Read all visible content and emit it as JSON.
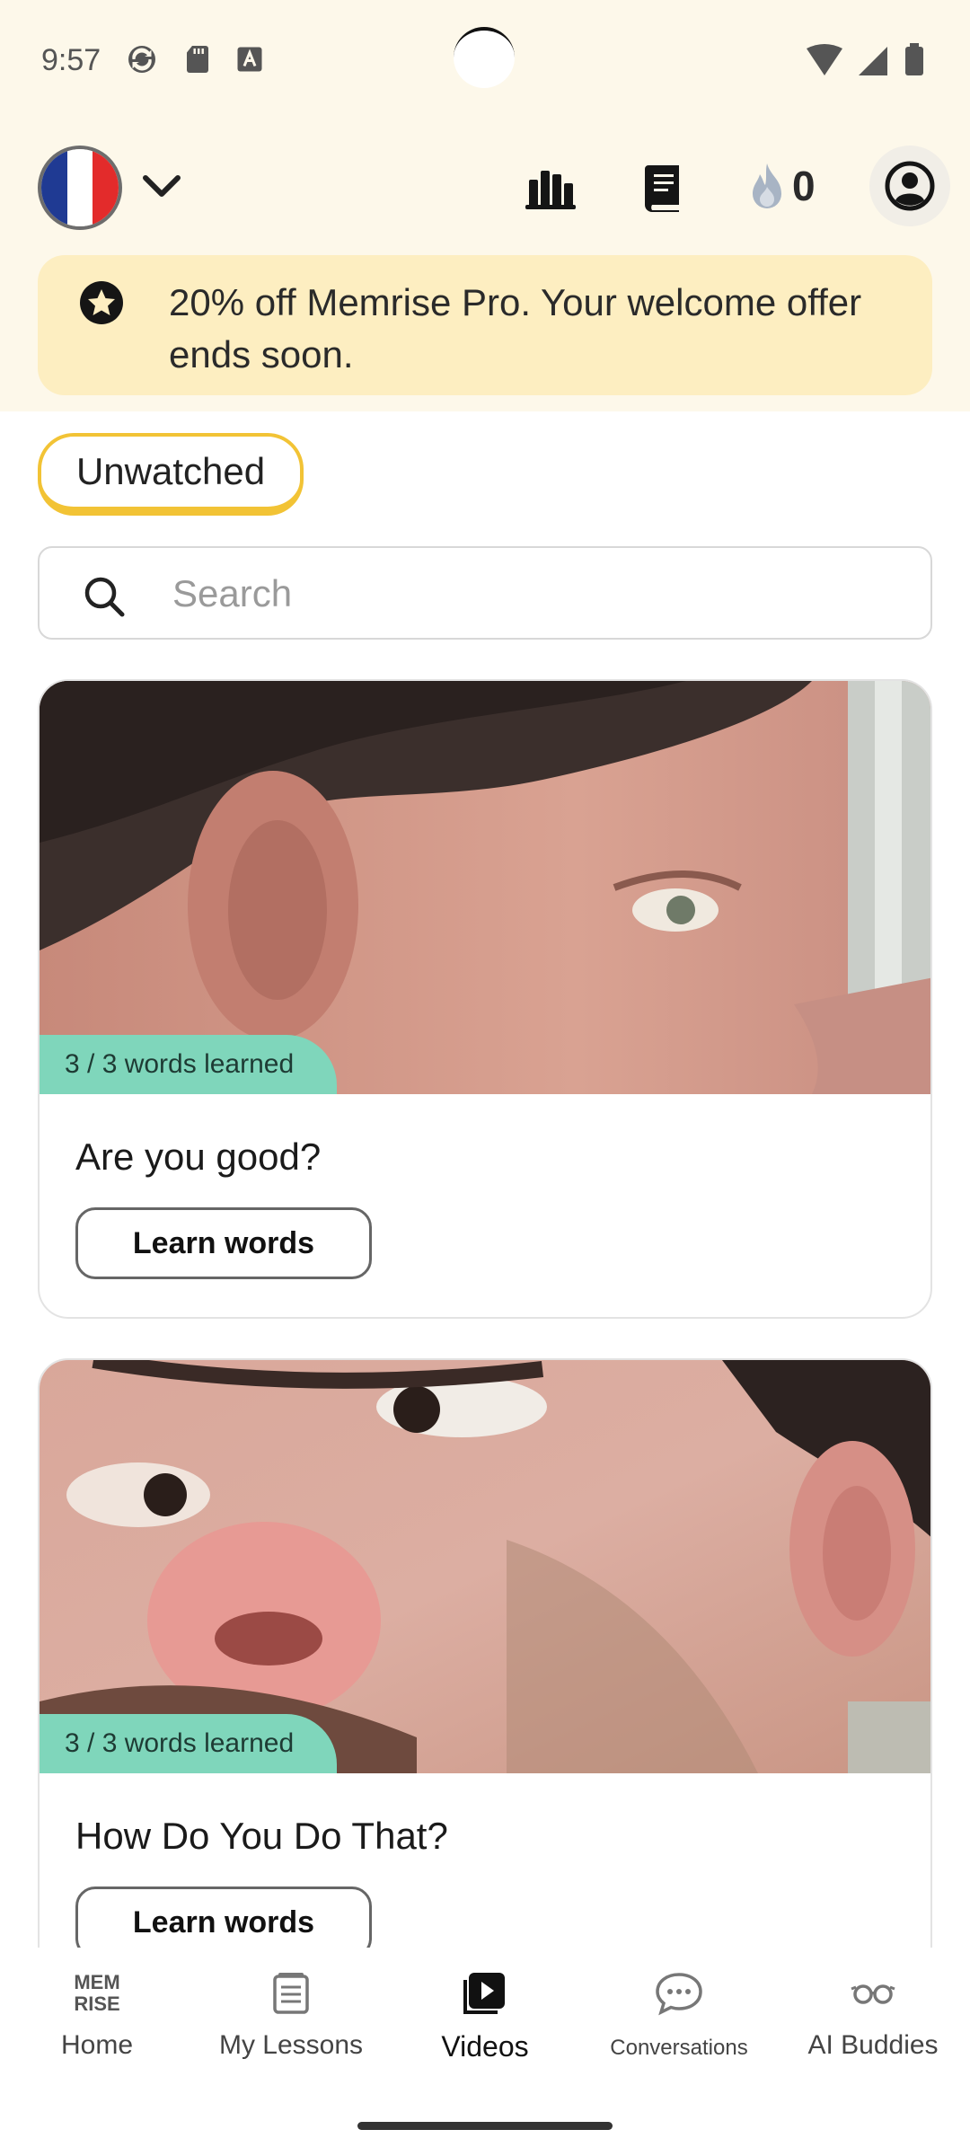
{
  "status_bar": {
    "time": "9:57"
  },
  "header": {
    "language_flag": "france-flag",
    "streak_count": "0"
  },
  "promo": {
    "text": "20% off Memrise Pro. Your welcome offer ends soon."
  },
  "filter": {
    "label": "Unwatched"
  },
  "search": {
    "placeholder": "Search"
  },
  "videos": [
    {
      "badge": "3 / 3 words learned",
      "title": "Are you good?",
      "button": "Learn words"
    },
    {
      "badge": "3 / 3 words learned",
      "title": "How Do You Do That?",
      "button": "Learn words"
    }
  ],
  "bottom_nav": {
    "items": [
      {
        "label": "Home",
        "icon": "memrise-logo-icon"
      },
      {
        "label": "My Lessons",
        "icon": "lessons-icon"
      },
      {
        "label": "Videos",
        "icon": "video-play-icon",
        "active": true
      },
      {
        "label": "Conversations",
        "icon": "chat-bubble-icon"
      },
      {
        "label": "AI Buddies",
        "icon": "glasses-icon"
      }
    ]
  },
  "colors": {
    "header_bg": "#fdf8ea",
    "promo_bg": "#fdeec1",
    "chip_accent": "#f2c335",
    "badge_bg": "#7fd6bb"
  }
}
